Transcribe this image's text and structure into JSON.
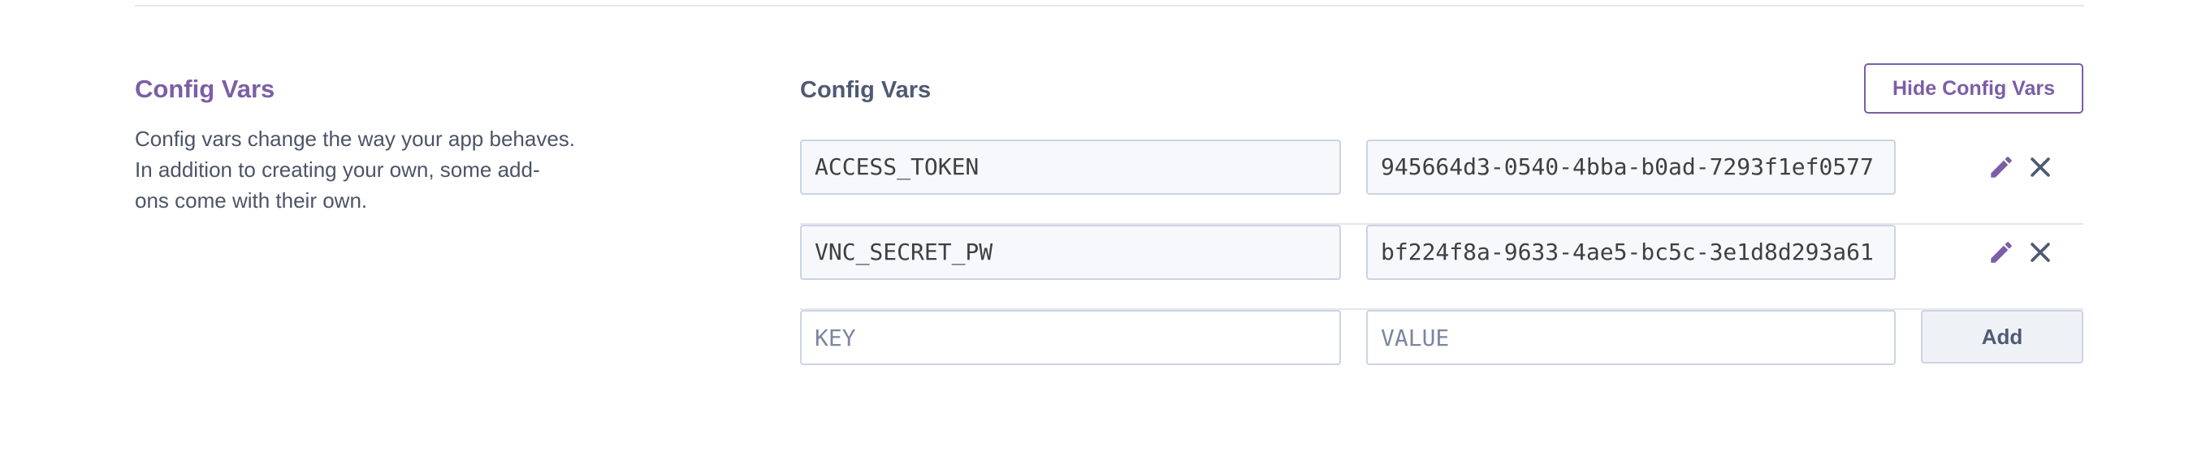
{
  "section": {
    "title": "Config Vars",
    "description_lines": [
      "Config vars change the way your app behaves.",
      "In addition to creating your own, some add-",
      "ons come with their own."
    ]
  },
  "panel": {
    "title": "Config Vars",
    "hide_button_label": "Hide Config Vars"
  },
  "vars": [
    {
      "key": "ACCESS_TOKEN",
      "value": "945664d3-0540-4bba-b0ad-7293f1ef0577"
    },
    {
      "key": "VNC_SECRET_PW",
      "value": "bf224f8a-9633-4ae5-bc5c-3e1d8d293a61"
    }
  ],
  "new_var": {
    "key_placeholder": "KEY",
    "value_placeholder": "VALUE",
    "add_label": "Add"
  },
  "icons": {
    "edit": "pencil-icon",
    "remove": "close-icon"
  },
  "colors": {
    "accent": "#7b5ea7",
    "heading": "#4f5a72",
    "text": "#4d5468",
    "border": "#ccd3e4"
  }
}
